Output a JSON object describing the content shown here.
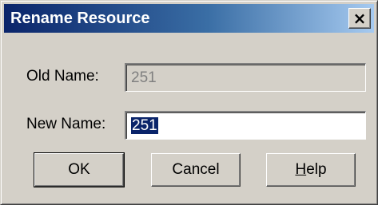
{
  "window": {
    "title": "Rename Resource",
    "close_glyph": "×"
  },
  "form": {
    "old_name_label": "Old Name:",
    "old_name_value": "251",
    "new_name_label": "New Name:",
    "new_name_value": "251"
  },
  "buttons": {
    "ok_label": "OK",
    "cancel_label": "Cancel",
    "help_mnemonic": "H",
    "help_rest": "elp"
  },
  "colors": {
    "dialog_face": "#d4d0c8",
    "title_start": "#0a246a",
    "title_end": "#a6caf0",
    "selection": "#0a246a"
  }
}
